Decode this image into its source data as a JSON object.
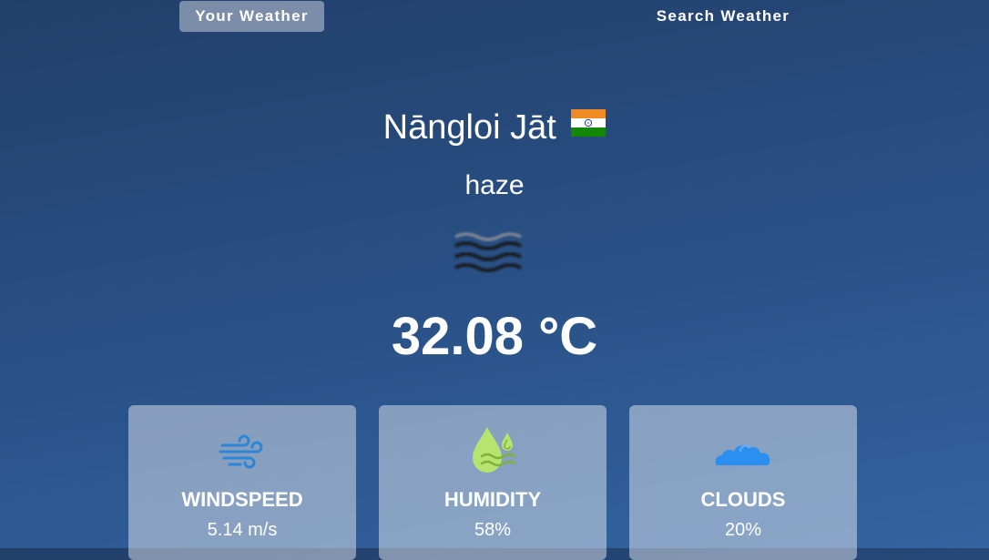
{
  "tabs": [
    {
      "label": "Your Weather",
      "active": true
    },
    {
      "label": "Search Weather",
      "active": false
    }
  ],
  "location": {
    "city": "Nāngloi Jāt",
    "flag_icon": "india-flag-icon"
  },
  "weather": {
    "condition": "haze",
    "condition_icon": "haze-icon",
    "temperature": "32.08 °C"
  },
  "stats": [
    {
      "label": "WINDSPEED",
      "value": "5.14 m/s",
      "icon": "wind-icon",
      "icon_color": "#2b86d6"
    },
    {
      "label": "HUMIDITY",
      "value": "58%",
      "icon": "humidity-icon",
      "icon_color": "#b7e36f"
    },
    {
      "label": "CLOUDS",
      "value": "20%",
      "icon": "clouds-icon",
      "icon_color": "#2a8ff0"
    }
  ],
  "colors": {
    "background_top": "#223f6a",
    "background_bottom": "#3363a0",
    "card_background": "rgba(255,255,255,0.43)"
  }
}
